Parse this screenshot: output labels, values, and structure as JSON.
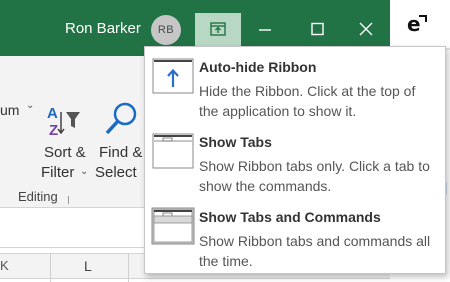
{
  "titlebar": {
    "user_name": "Ron Barker",
    "avatar_initials": "RB",
    "colors": {
      "bg": "#217346",
      "ribbon_btn_active": "#b8d8c3"
    }
  },
  "window_controls": {
    "ribbon_options_icon": "ribbon-display-options-icon",
    "minimize_icon": "minimize-icon",
    "maximize_icon": "maximize-icon",
    "close_icon": "close-icon"
  },
  "ribbon": {
    "partial_left_label": "um",
    "sort_filter": {
      "line1": "Sort &",
      "line2": "Filter"
    },
    "find_select": {
      "line1": "Find &",
      "line2": "Select"
    },
    "group_label": "Editing"
  },
  "grid": {
    "column_partial": "K",
    "column_l": "L"
  },
  "ribbon_display_menu": {
    "items": [
      {
        "title": "Auto-hide Ribbon",
        "description": "Hide the Ribbon. Click at the top of the application to show it.",
        "icon": "auto-hide-ribbon-icon"
      },
      {
        "title": "Show Tabs",
        "description": "Show Ribbon tabs only. Click a tab to show the commands.",
        "icon": "show-tabs-icon"
      },
      {
        "title": "Show Tabs and Commands",
        "description": "Show Ribbon tabs and commands all the time.",
        "icon": "show-tabs-and-commands-icon",
        "selected": true
      }
    ]
  },
  "side_icon": "edge-browser-icon"
}
